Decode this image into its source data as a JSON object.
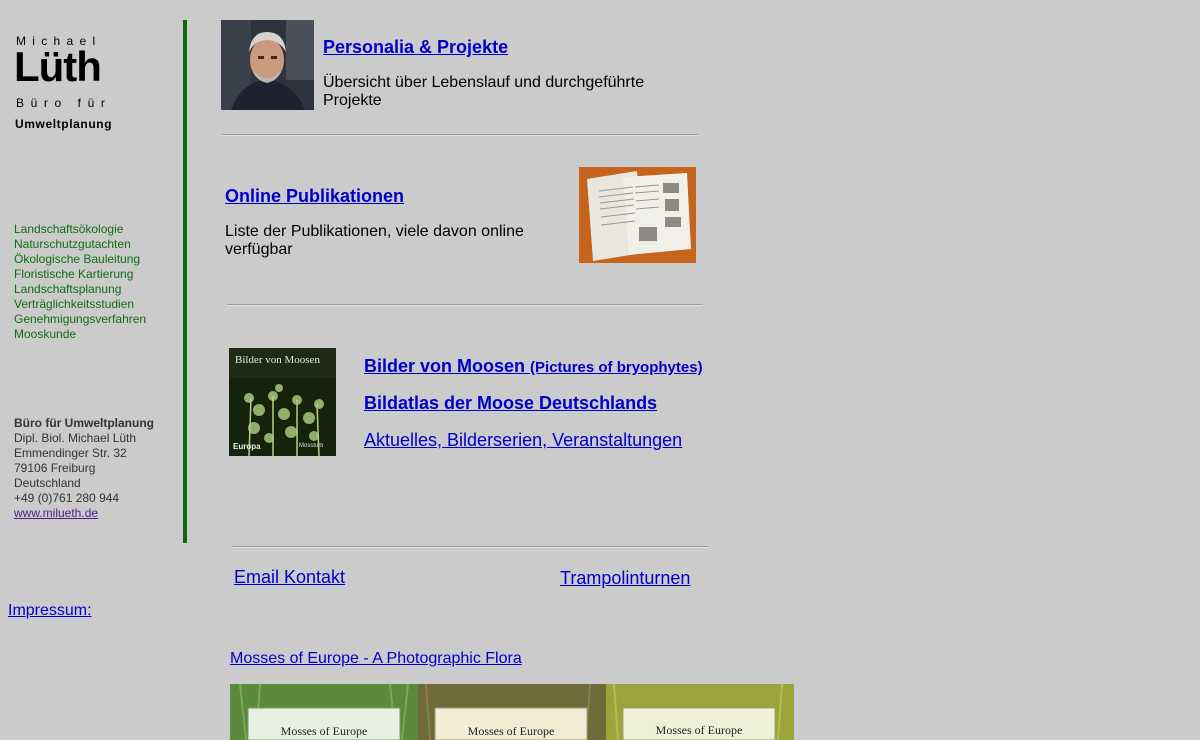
{
  "logo": {
    "line1": "Michael",
    "line2": "Lüth",
    "line3": "Büro für",
    "line4": "Umweltplanung"
  },
  "sidebar": {
    "services": [
      "Landschaftsökologie",
      "Naturschutzgutachten",
      "Ökologische Bauleitung",
      "Floristische Kartierung",
      "Landschaftsplanung",
      "Verträglichkeitsstudien",
      "Genehmigungsverfahren",
      "Mooskunde"
    ],
    "contact": {
      "company": "Büro für Umweltplanung",
      "name": "Dipl. Biol. Michael Lüth",
      "street": "Emmendinger Str. 32",
      "city": "79106 Freiburg",
      "country": "Deutschland",
      "phone": "+49 (0)761 280 944",
      "website": "www.milueth.de"
    },
    "impressum": "Impressum:"
  },
  "main": {
    "personalia": {
      "title": "Personalia & Projekte",
      "desc": "Übersicht über Lebenslauf und durchgeführte Projekte"
    },
    "publications": {
      "title": "Online Publikationen",
      "desc": "Liste der Publikationen, viele davon online verfügbar"
    },
    "moss": {
      "book_title": "Bilder von Moosen",
      "book_sub": "Europa",
      "book_sub2": "Mosstum",
      "link1_main": "Bilder von Moosen",
      "link1_sub": "(Pictures of bryophytes)",
      "link2": "Bildatlas der Moose Deutschlands",
      "link3": "Aktuelles, Bilderserien, Veranstaltungen"
    },
    "footer_links": {
      "email": "Email Kontakt",
      "trampolin": "Trampolinturnen"
    },
    "mosses_europe": {
      "link": "Mosses of Europe - A Photographic Flora",
      "cover_label": "Mosses of Europe"
    }
  },
  "colors": {
    "background": "#cbcbcb",
    "link": "#0000cc",
    "visited": "#551a8b",
    "sidebar_green": "#106d10",
    "bar_green": "#0e6a0e"
  }
}
